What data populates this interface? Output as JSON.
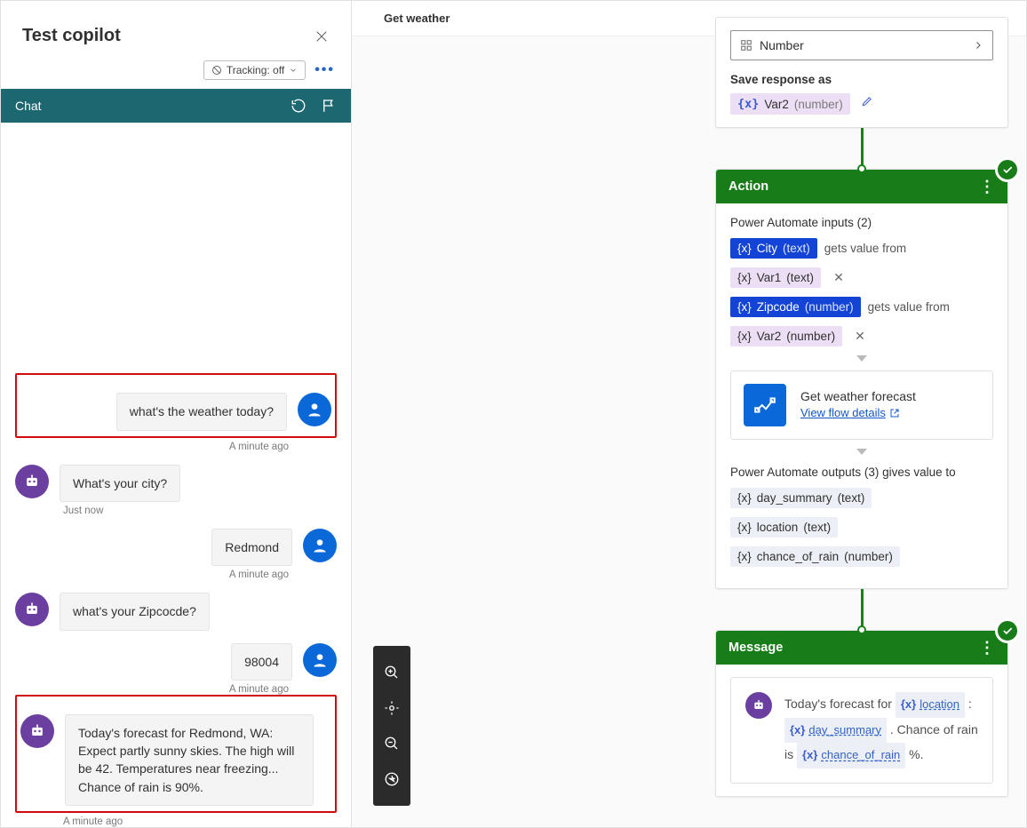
{
  "left": {
    "title": "Test copilot",
    "tracking_label": "Tracking: off",
    "chat_tab": "Chat",
    "messages": [
      {
        "role": "user",
        "text": "what's the weather today?",
        "time": "A minute ago",
        "highlight": true
      },
      {
        "role": "bot",
        "text": "What's your city?",
        "time": "Just now",
        "highlight": false
      },
      {
        "role": "user",
        "text": "Redmond",
        "time": "A minute ago",
        "highlight": false
      },
      {
        "role": "bot",
        "text": "what's your Zipcocde?",
        "time": "",
        "highlight": false
      },
      {
        "role": "user",
        "text": "98004",
        "time": "A minute ago",
        "highlight": false
      },
      {
        "role": "bot",
        "text": "Today's forecast for Redmond, WA: Expect partly sunny skies. The high will be 42. Temperatures near freezing... Chance of rain is 90%.",
        "time": "A minute ago",
        "highlight": true
      }
    ]
  },
  "right": {
    "header": "Get weather",
    "number_select": "Number",
    "save_as_label": "Save response as",
    "save_as_var": {
      "name": "Var2",
      "type": "number"
    },
    "action": {
      "title": "Action",
      "inputs_label": "Power Automate inputs (2)",
      "gets_value": "gets value from",
      "inputs": [
        {
          "param": {
            "name": "City",
            "type": "text"
          },
          "from": {
            "name": "Var1",
            "type": "text"
          }
        },
        {
          "param": {
            "name": "Zipcode",
            "type": "number"
          },
          "from": {
            "name": "Var2",
            "type": "number"
          }
        }
      ],
      "flow": {
        "title": "Get weather forecast",
        "link": "View flow details"
      },
      "outputs_label": "Power Automate outputs (3) gives value to",
      "outputs": [
        {
          "name": "day_summary",
          "type": "text"
        },
        {
          "name": "location",
          "type": "text"
        },
        {
          "name": "chance_of_rain",
          "type": "number"
        }
      ]
    },
    "message": {
      "title": "Message",
      "prefix": "Today's forecast for",
      "var1": "location",
      "mid1": ":",
      "var2": "day_summary",
      "mid2": ". Chance of rain is",
      "var3": "chance_of_rain",
      "suffix": "%."
    }
  }
}
